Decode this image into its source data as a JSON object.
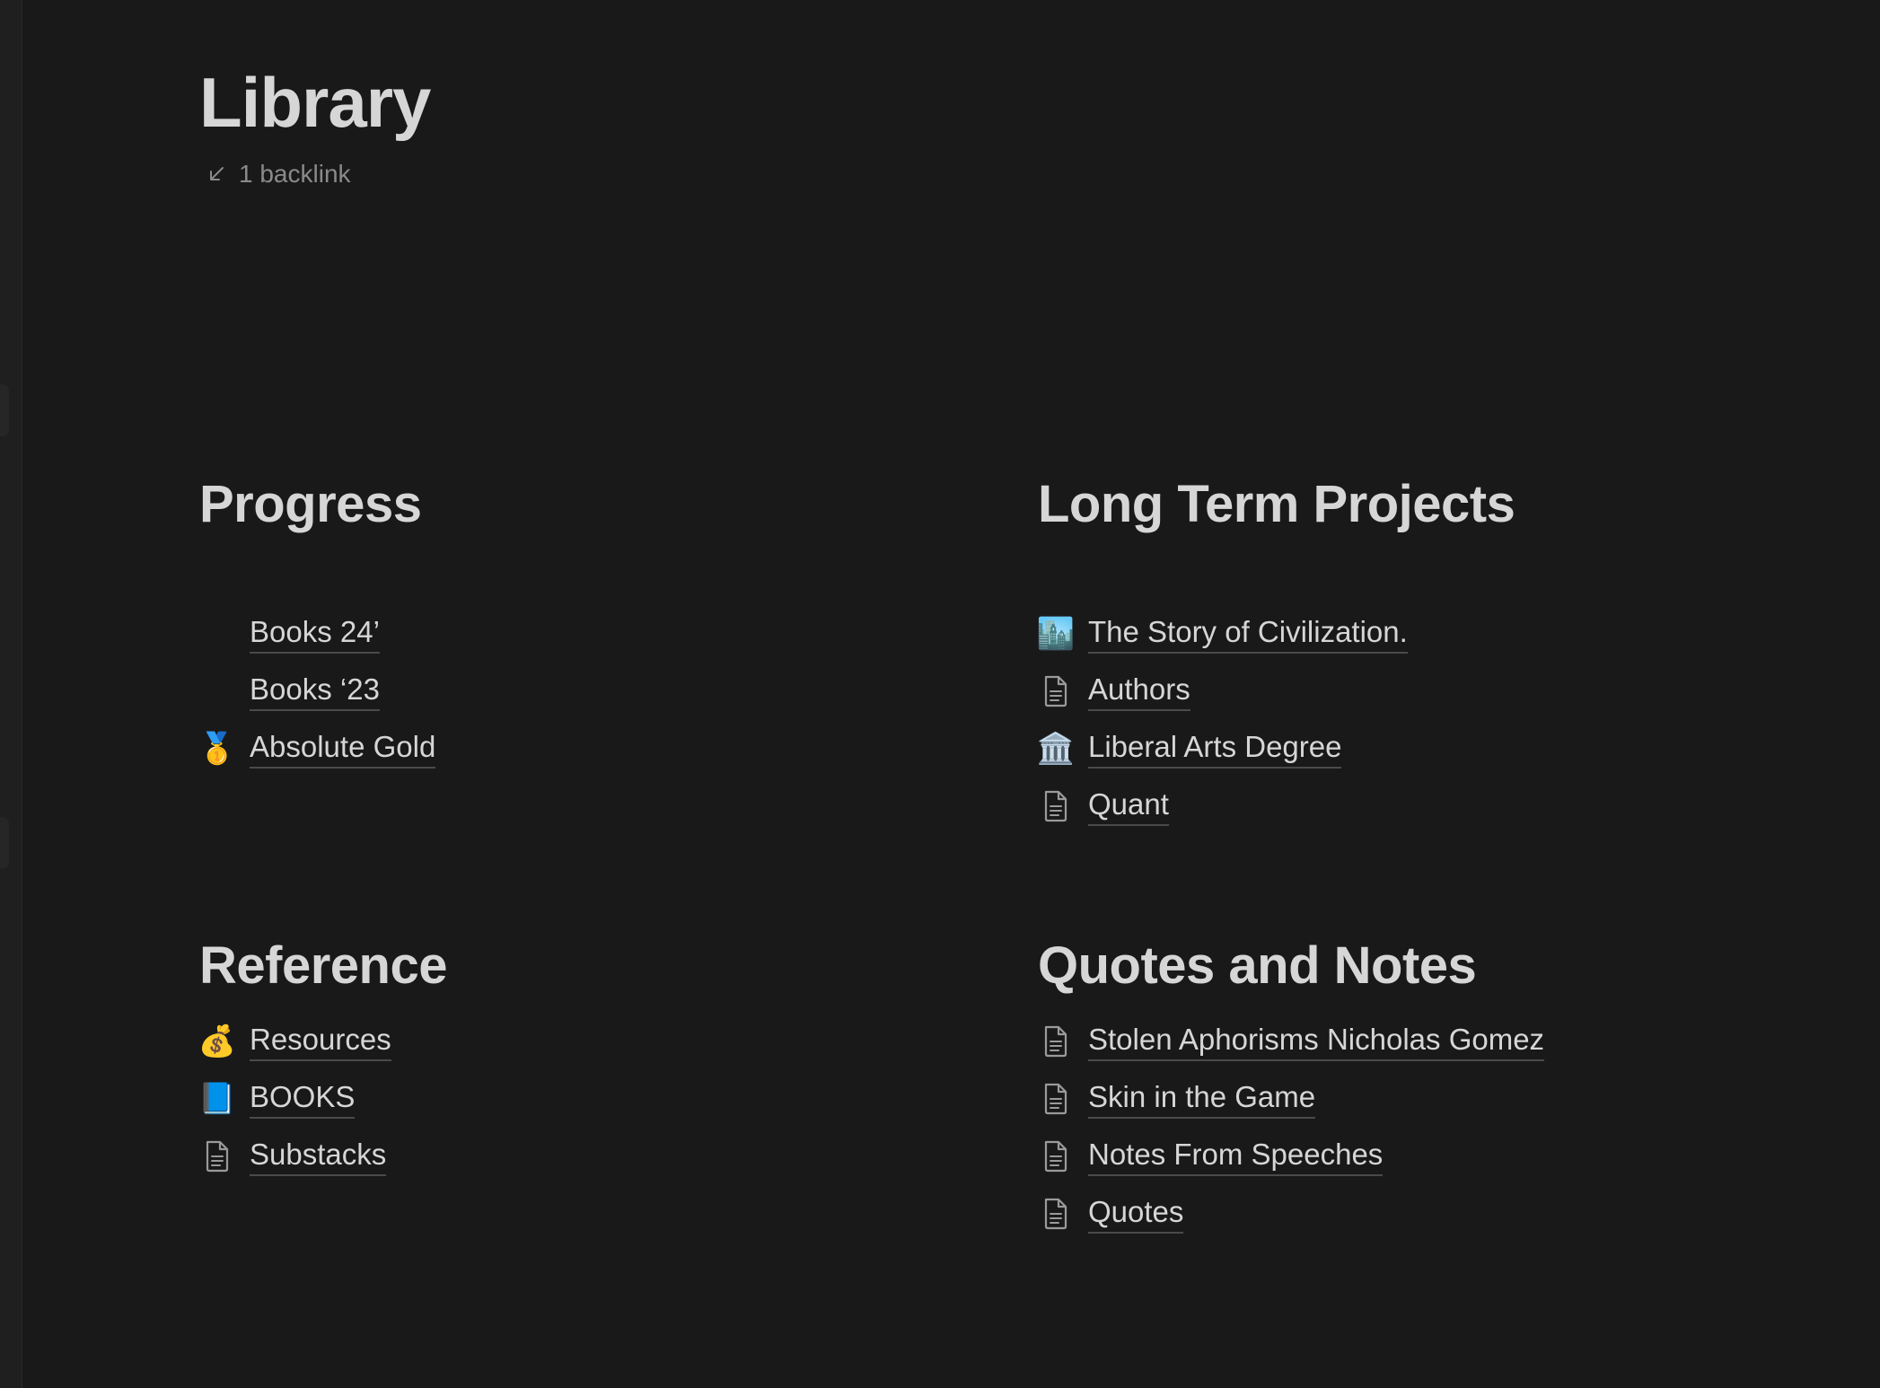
{
  "page": {
    "title": "Library",
    "backlink_label": "1 backlink"
  },
  "sections": {
    "progress": {
      "heading": "Progress",
      "items": [
        {
          "label": "Books 24’",
          "icon": "none"
        },
        {
          "label": "Books ‘23",
          "icon": "none"
        },
        {
          "label": "Absolute Gold",
          "icon": "medal-icon",
          "emoji": "🥇"
        }
      ]
    },
    "long_term": {
      "heading": "Long Term Projects",
      "items": [
        {
          "label": "The Story of Civilization.",
          "icon": "cityscape-icon",
          "emoji": "🏙️"
        },
        {
          "label": "Authors",
          "icon": "document-icon"
        },
        {
          "label": "Liberal Arts Degree",
          "icon": "classical-building-icon",
          "emoji": "🏛️"
        },
        {
          "label": "Quant",
          "icon": "document-icon"
        }
      ]
    },
    "reference": {
      "heading": "Reference",
      "items": [
        {
          "label": "Resources",
          "icon": "money-bag-icon",
          "emoji": "💰"
        },
        {
          "label": "BOOKS",
          "icon": "blue-book-icon",
          "emoji": "📘"
        },
        {
          "label": "Substacks",
          "icon": "document-icon"
        }
      ]
    },
    "quotes": {
      "heading": "Quotes and Notes",
      "items": [
        {
          "label": "Stolen Aphorisms Nicholas Gomez",
          "icon": "document-icon"
        },
        {
          "label": "Skin in the Game",
          "icon": "document-icon"
        },
        {
          "label": "Notes From Speeches",
          "icon": "document-icon"
        },
        {
          "label": "Quotes",
          "icon": "document-icon"
        }
      ]
    }
  }
}
